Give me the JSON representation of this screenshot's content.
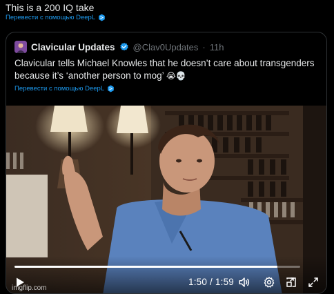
{
  "post": {
    "text": "This is a 200 IQ take",
    "translate_label": "Перевести с помощью DeepL"
  },
  "quote": {
    "author": "Clavicular Updates",
    "handle": "@Clav0Updates",
    "separator": "·",
    "time": "11h",
    "text": "Clavicular tells Michael Knowles that he doesn’t care about transgenders because it’s ‘another person to mog’",
    "emojis": "😭💀",
    "translate_label": "Перевести с помощью DeepL"
  },
  "video": {
    "time_display": "1:50 / 1:59",
    "progress_fraction": 0.92,
    "watermark": "imgflip.com"
  },
  "colors": {
    "link": "#1d9bf0",
    "verified": "#1d9bf0",
    "muted": "#71767b"
  },
  "icons": {
    "translate": "deepl-icon",
    "verified": "verified-badge-icon",
    "play": "play-icon",
    "volume": "volume-icon",
    "settings": "gear-icon",
    "pip": "picture-in-picture-icon",
    "fullscreen": "fullscreen-icon"
  }
}
